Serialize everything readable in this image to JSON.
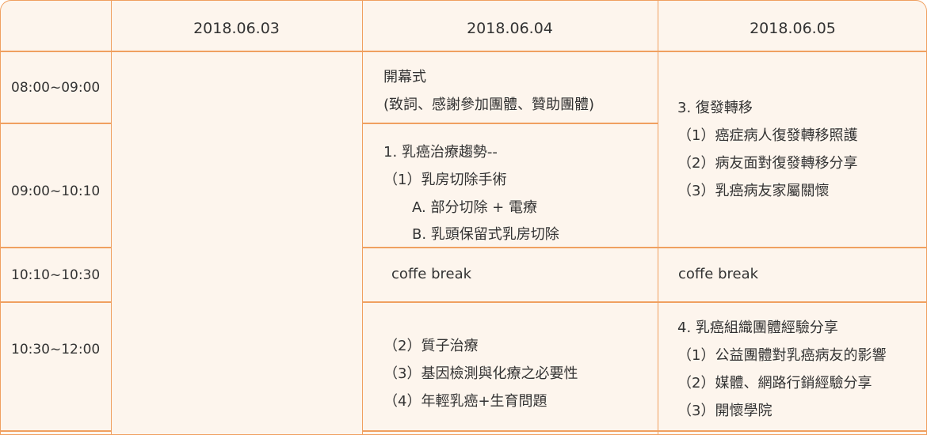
{
  "table": {
    "dates": [
      "2018.06.03",
      "2018.06.04",
      "2018.06.05"
    ],
    "times": [
      "08:00~09:00",
      "09:00~10:10",
      "10:10~10:30",
      "10:30~12:00"
    ],
    "day2": {
      "opening": [
        "開幕式",
        "(致詞、感謝參加團體、贊助團體)"
      ],
      "session1": [
        "1. 乳癌治療趨勢--",
        "（1）乳房切除手術",
        "A. 部分切除 + 電療",
        "B. 乳頭保留式乳房切除"
      ],
      "break": "coffe break",
      "session2": [
        "（2）質子治療",
        "（3）基因檢測與化療之必要性",
        "（4）年輕乳癌+生育問題"
      ]
    },
    "day3": {
      "session3": [
        "3.  復發轉移",
        "（1）癌症病人復發轉移照護",
        "（2）病友面對復發轉移分享",
        "（3）乳癌病友家屬關懷"
      ],
      "break": "coffe break",
      "session4": [
        "4.  乳癌組織團體經驗分享",
        "（1）公益團體對乳癌病友的影響",
        "（2）媒體、網路行銷經驗分享",
        "（3）開懷學院"
      ]
    }
  },
  "colors": {
    "border": "#f0a060",
    "background": "#fdf5ed",
    "text": "#333333"
  }
}
